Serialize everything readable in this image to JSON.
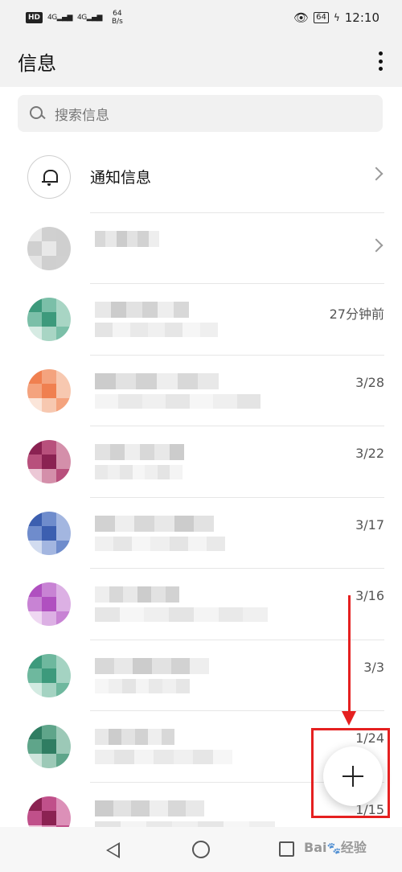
{
  "status_bar": {
    "hd": "HD",
    "sig1": "4G",
    "sig2": "4G",
    "speed_value": "64",
    "speed_unit": "B/s",
    "battery": "64",
    "time": "12:10"
  },
  "app_bar": {
    "title": "信息"
  },
  "search": {
    "placeholder": "搜索信息"
  },
  "notification_row": {
    "title": "通知信息"
  },
  "conversations": [
    {
      "time": "",
      "colors": [
        "#e8e8e8",
        "#d0d0d0",
        "#cfcfcf",
        "#e4e4e4"
      ]
    },
    {
      "time": "27分钟前",
      "colors": [
        "#3d9a7c",
        "#7bbfa8",
        "#a8d5c4",
        "#d6ebe3"
      ]
    },
    {
      "time": "3/28",
      "colors": [
        "#f08050",
        "#f4a37e",
        "#f7c8b0",
        "#fbe5d9"
      ]
    },
    {
      "time": "3/22",
      "colors": [
        "#8b2252",
        "#b8507c",
        "#d48faa",
        "#ecc8d6"
      ]
    },
    {
      "time": "3/17",
      "colors": [
        "#3c5fb0",
        "#6f8ccc",
        "#a3b6e0",
        "#d2dcf0"
      ]
    },
    {
      "time": "3/16",
      "colors": [
        "#b050c0",
        "#c883d4",
        "#dcb0e4",
        "#efd8f2"
      ]
    },
    {
      "time": "3/3",
      "colors": [
        "#3d9a7c",
        "#6eb89e",
        "#a4d3c2",
        "#d3ebe2"
      ]
    },
    {
      "time": "1/24",
      "colors": [
        "#2f7d62",
        "#5fa58a",
        "#9cc9b7",
        "#cfe5dc"
      ]
    },
    {
      "time": "1/15",
      "colors": [
        "#8b2252",
        "#c0508a",
        "#dc90b8",
        "#f0c8dc"
      ]
    }
  ],
  "fab": {
    "icon": "plus-icon"
  },
  "annotation": {
    "color": "#e52020"
  },
  "nav": {
    "back_icon": "back-icon",
    "home_icon": "home-icon",
    "recent_icon": "recent-apps-icon"
  },
  "watermark": "Bai 经验"
}
